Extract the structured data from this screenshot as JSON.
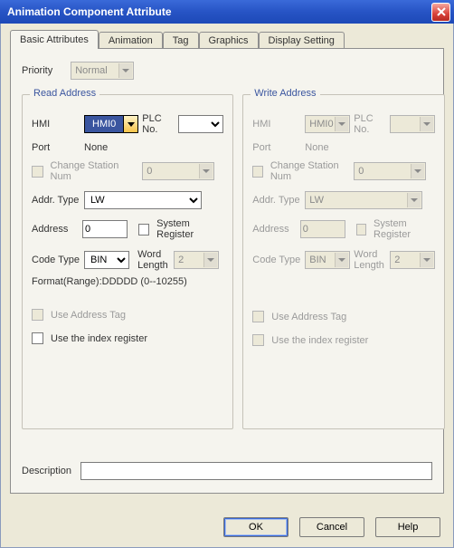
{
  "window": {
    "title": "Animation Component Attribute"
  },
  "tabs": [
    "Basic Attributes",
    "Animation",
    "Tag",
    "Graphics",
    "Display Setting"
  ],
  "priority": {
    "label": "Priority",
    "value": "Normal"
  },
  "read": {
    "legend": "Read Address",
    "hmi_label": "HMI",
    "hmi_value": "HMI0",
    "plc_label": "PLC No.",
    "plc_value": "",
    "port_label": "Port",
    "port_value": "None",
    "change_station_label": "Change Station Num",
    "change_station_value": "0",
    "addr_type_label": "Addr. Type",
    "addr_type_value": "LW",
    "address_label": "Address",
    "address_value": "0",
    "system_register_label": "System Register",
    "code_type_label": "Code Type",
    "code_type_value": "BIN",
    "word_length_label": "Word Length",
    "word_length_value": "2",
    "format_label": "Format(Range):DDDDD (0--10255)",
    "use_address_tag_label": "Use Address Tag",
    "use_index_register_label": "Use the index register"
  },
  "write": {
    "legend": "Write Address",
    "hmi_label": "HMI",
    "hmi_value": "HMI0",
    "plc_label": "PLC No.",
    "plc_value": "",
    "port_label": "Port",
    "port_value": "None",
    "change_station_label": "Change Station Num",
    "change_station_value": "0",
    "addr_type_label": "Addr. Type",
    "addr_type_value": "LW",
    "address_label": "Address",
    "address_value": "0",
    "system_register_label": "System Register",
    "code_type_label": "Code Type",
    "code_type_value": "BIN",
    "word_length_label": "Word Length",
    "word_length_value": "2",
    "use_address_tag_label": "Use Address Tag",
    "use_index_register_label": "Use the index register"
  },
  "description": {
    "label": "Description",
    "value": ""
  },
  "buttons": {
    "ok": "OK",
    "cancel": "Cancel",
    "help": "Help"
  }
}
